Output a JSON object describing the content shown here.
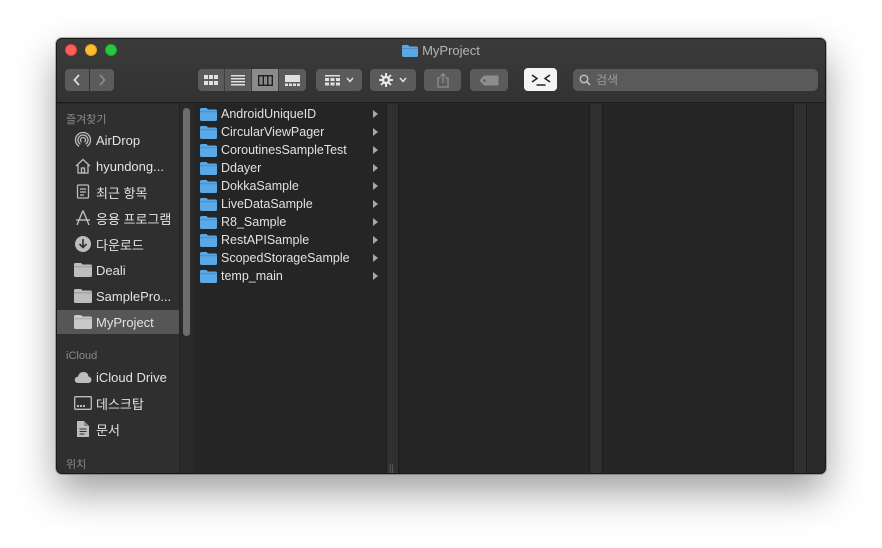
{
  "window": {
    "title": "MyProject"
  },
  "toolbar": {
    "back": "‹",
    "forward": "›",
    "view_modes": [
      "icon-view",
      "list-view",
      "column-view",
      "gallery-view"
    ],
    "active_view": "column-view",
    "group_label": "group-by",
    "action_label": "action",
    "share_label": "share",
    "tag_label": "tags",
    "terminal_label": ">_<",
    "search": {
      "placeholder": "검색",
      "value": ""
    }
  },
  "sidebar": {
    "favorites_heading": "즐겨찾기",
    "favorites": [
      {
        "label": "AirDrop",
        "icon": "airdrop-icon"
      },
      {
        "label": "hyundong...",
        "icon": "home-icon"
      },
      {
        "label": "최근 항목",
        "icon": "recents-icon"
      },
      {
        "label": "응용 프로그램",
        "icon": "applications-icon"
      },
      {
        "label": "다운로드",
        "icon": "downloads-icon"
      },
      {
        "label": "Deali",
        "icon": "folder-icon"
      },
      {
        "label": "SamplePro...",
        "icon": "folder-icon"
      },
      {
        "label": "MyProject",
        "icon": "folder-icon",
        "selected": true
      }
    ],
    "icloud_heading": "iCloud",
    "icloud": [
      {
        "label": "iCloud Drive",
        "icon": "cloud-icon"
      },
      {
        "label": "데스크탑",
        "icon": "desktop-icon"
      },
      {
        "label": "문서",
        "icon": "document-icon"
      }
    ],
    "locations_heading": "위치"
  },
  "column1": {
    "items": [
      "AndroidUniqueID",
      "CircularViewPager",
      "CoroutinesSampleTest",
      "Ddayer",
      "DokkaSample",
      "LiveDataSample",
      "R8_Sample",
      "RestAPISample",
      "ScopedStorageSample",
      "temp_main"
    ]
  },
  "colors": {
    "folder_blue": "#5aa8e6",
    "selection": "#565656",
    "window_bg": "#282828"
  }
}
